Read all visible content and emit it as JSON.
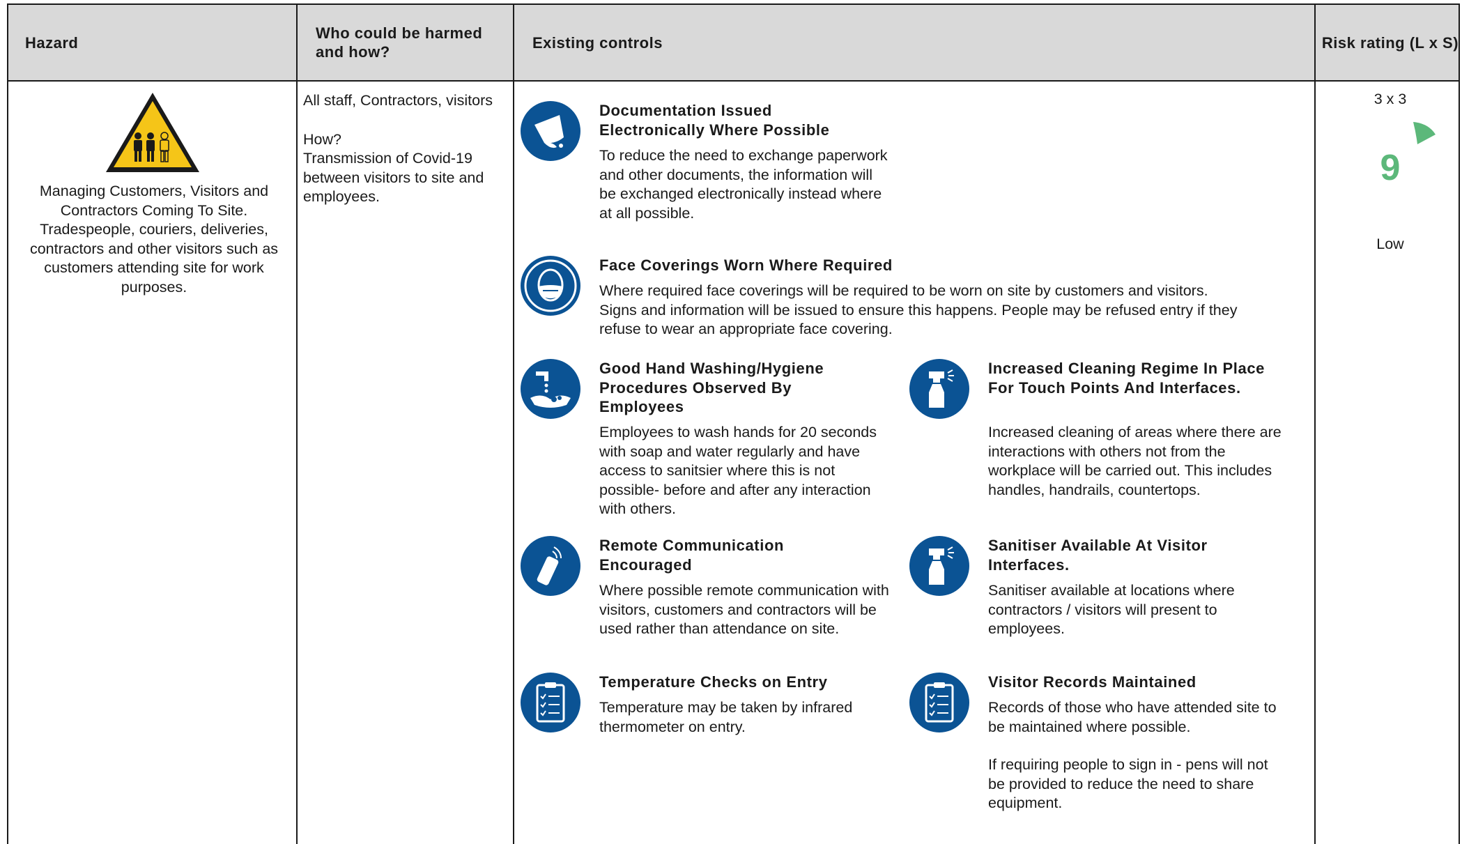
{
  "header": {
    "hazard": "Hazard",
    "who": "Who could be harmed and how?",
    "controls": "Existing controls",
    "risk": "Risk rating (L x S)"
  },
  "hazard": {
    "icon": "people-warning-triangle-icon",
    "text": "Managing Customers, Visitors and Contractors Coming To Site. Tradespeople, couriers, deliveries, contractors and other visitors such as customers attending site for work purposes."
  },
  "who": {
    "line1": "All staff, Contractors, visitors",
    "how_label": "How?",
    "how_text": "Transmission of Covid-19 between visitors to site and employees."
  },
  "controls": [
    {
      "icon": "document-icon",
      "title": "Documentation Issued Electronically Where Possible",
      "desc": "To reduce the need to exchange paperwork and other documents, the information will be exchanged electronically instead where at all possible."
    },
    {
      "icon": "face-mask-icon",
      "title": "Face Coverings Worn Where Required",
      "desc": "Where required face coverings will be required to be worn on site by customers and visitors. Signs and information will be issued to ensure this happens. People may be refused entry if they refuse to wear an appropriate face covering."
    },
    {
      "icon": "hand-washing-icon",
      "title": "Good Hand Washing/Hygiene Procedures Observed By Employees",
      "desc": "Employees to wash hands for 20 seconds with soap and water regularly and have access to sanitsier where this is not possible- before and after any interaction with others."
    },
    {
      "icon": "spray-bottle-icon",
      "title": "Increased Cleaning Regime In Place For Touch Points And Interfaces.",
      "desc": "Increased cleaning of areas where there are interactions with others not from the workplace will be carried out. This includes handles, handrails, countertops."
    },
    {
      "icon": "remote-phone-icon",
      "title": "Remote Communication Encouraged",
      "desc": "Where possible remote communication with visitors, customers and contractors will be used rather than attendance on site."
    },
    {
      "icon": "spray-bottle-icon",
      "title": "Sanitiser Available At Visitor Interfaces.",
      "desc": "Sanitiser available at locations where contractors / visitors will present to employees."
    },
    {
      "icon": "clipboard-checklist-icon",
      "title": "Temperature Checks on Entry",
      "desc": "Temperature may be taken by infrared thermometer on entry."
    },
    {
      "icon": "clipboard-checklist-icon",
      "title": "Visitor Records Maintained",
      "desc": "Records of those who have attended site to be maintained where possible.",
      "desc2": "If requiring people to sign in - pens will not be provided to reduce the need to share equipment."
    }
  ],
  "risk": {
    "lxs": "3 x 3",
    "score": "9",
    "level": "Low",
    "gauge_icon": "risk-gauge-icon",
    "gauge_color": "#5cb87a"
  },
  "colors": {
    "header_bg": "#d9d9d9",
    "icon_blue": "#0b5394",
    "warning_yellow": "#f5c518"
  }
}
